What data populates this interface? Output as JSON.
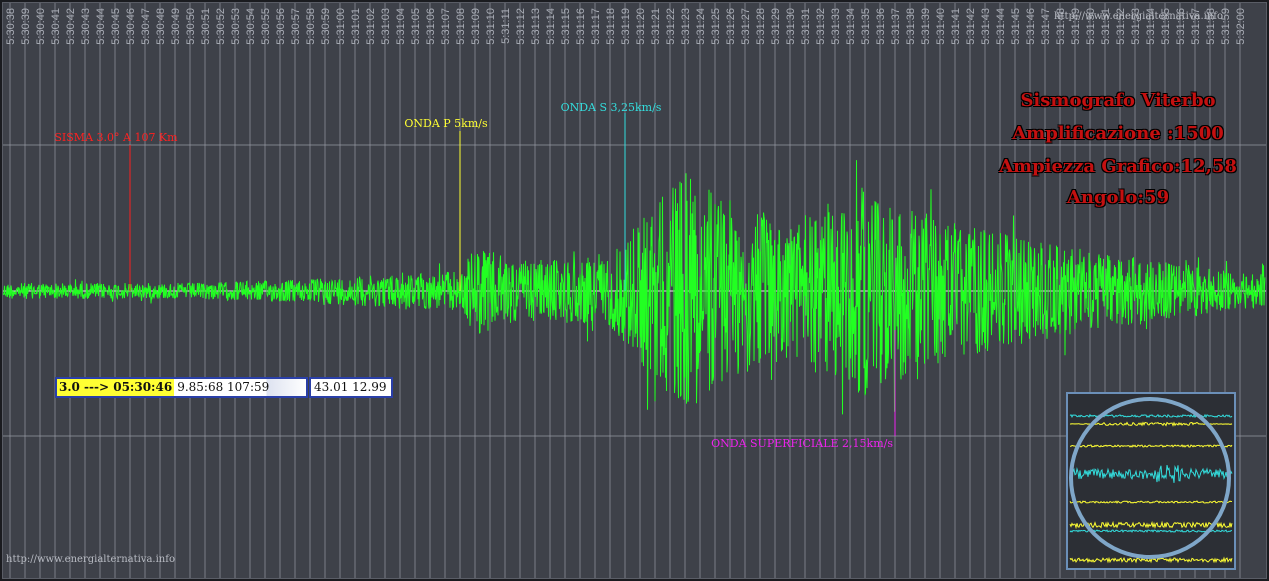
{
  "watermark_top": "http://www.energialternativa.info",
  "watermark_bottom": "http://www.energialternativa.info",
  "title_lines": [
    "Sismografo Viterbo",
    "Amplificazione :1500",
    "Ampiezza Grafico:12,58",
    "Angolo:59"
  ],
  "info_box": {
    "magnitude_time": "3.0 ---> 05:30:46",
    "coords": "9.85:68 107:59",
    "position": "43.01 12.99"
  },
  "colors": {
    "background": "#3e4149",
    "grid": "#8e929b",
    "trace": "#22ff22",
    "baseline": "#e8e8e8",
    "sisma": "#ff2020",
    "onda_p": "#ffff33",
    "onda_s": "#33dddd",
    "onda_superficiale": "#ee22ee",
    "title": "#c41010"
  },
  "chart_data": {
    "type": "line",
    "x_start": "05:30:38",
    "x_end": "05:32:00",
    "ticks": [
      "5:30:38",
      "5:30:39",
      "5:30:40",
      "5:30:41",
      "5:30:42",
      "5:30:43",
      "5:30:44",
      "5:30:45",
      "5:30:46",
      "5:30:47",
      "5:30:48",
      "5:30:49",
      "5:30:50",
      "5:30:51",
      "5:30:52",
      "5:30:53",
      "5:30:54",
      "5:30:55",
      "5:30:56",
      "5:30:57",
      "5:30:58",
      "5:30:59",
      "5:31:00",
      "5:31:01",
      "5:31:02",
      "5:31:03",
      "5:31:04",
      "5:31:05",
      "5:31:06",
      "5:31:07",
      "5:31:08",
      "5:31:09",
      "5:31:10",
      "5:31:11",
      "5:31:12",
      "5:31:13",
      "5:31:14",
      "5:31:15",
      "5:31:16",
      "5:31:17",
      "5:31:18",
      "5:31:19",
      "5:31:20",
      "5:31:21",
      "5:31:22",
      "5:31:23",
      "5:31:24",
      "5:31:25",
      "5:31:26",
      "5:31:27",
      "5:31:28",
      "5:31:29",
      "5:31:30",
      "5:31:31",
      "5:31:32",
      "5:31:33",
      "5:31:34",
      "5:31:35",
      "5:31:36",
      "5:31:37",
      "5:31:38",
      "5:31:39",
      "5:31:40",
      "5:31:41",
      "5:31:42",
      "5:31:43",
      "5:31:44",
      "5:31:45",
      "5:31:46",
      "5:31:47",
      "5:31:48",
      "5:31:49",
      "5:31:50",
      "5:31:51",
      "5:31:52",
      "5:31:53",
      "5:31:54",
      "5:31:55",
      "5:31:56",
      "5:31:57",
      "5:31:58",
      "5:31:59",
      "5:32:00"
    ],
    "markers": [
      {
        "label": "SISMA 3.0° A 107 Km",
        "time": "05:30:46",
        "color": "#ff2020",
        "key": "sisma"
      },
      {
        "label": "ONDA P 5km/s",
        "time": "05:31:08",
        "color": "#ffff33",
        "key": "onda_p"
      },
      {
        "label": "ONDA S 3,25km/s",
        "time": "05:31:19",
        "color": "#33dddd",
        "key": "onda_s"
      },
      {
        "label": "ONDA SUPERFICIALE 2,15km/s",
        "time": "05:31:37",
        "color": "#ee22ee",
        "key": "onda_superficiale"
      }
    ],
    "envelope": [
      {
        "t": "05:30:38",
        "amp": 8
      },
      {
        "t": "05:30:50",
        "amp": 8
      },
      {
        "t": "05:30:58",
        "amp": 12
      },
      {
        "t": "05:31:05",
        "amp": 18
      },
      {
        "t": "05:31:08",
        "amp": 20
      },
      {
        "t": "05:31:09",
        "amp": 45
      },
      {
        "t": "05:31:12",
        "amp": 30
      },
      {
        "t": "05:31:18",
        "amp": 35
      },
      {
        "t": "05:31:20",
        "amp": 75
      },
      {
        "t": "05:31:23",
        "amp": 120
      },
      {
        "t": "05:31:26",
        "amp": 90
      },
      {
        "t": "05:31:30",
        "amp": 70
      },
      {
        "t": "05:31:35",
        "amp": 105
      },
      {
        "t": "05:31:38",
        "amp": 85
      },
      {
        "t": "05:31:42",
        "amp": 65
      },
      {
        "t": "05:31:48",
        "amp": 45
      },
      {
        "t": "05:31:55",
        "amp": 30
      },
      {
        "t": "05:32:00",
        "amp": 18
      }
    ],
    "grid": true,
    "legend": "none"
  }
}
